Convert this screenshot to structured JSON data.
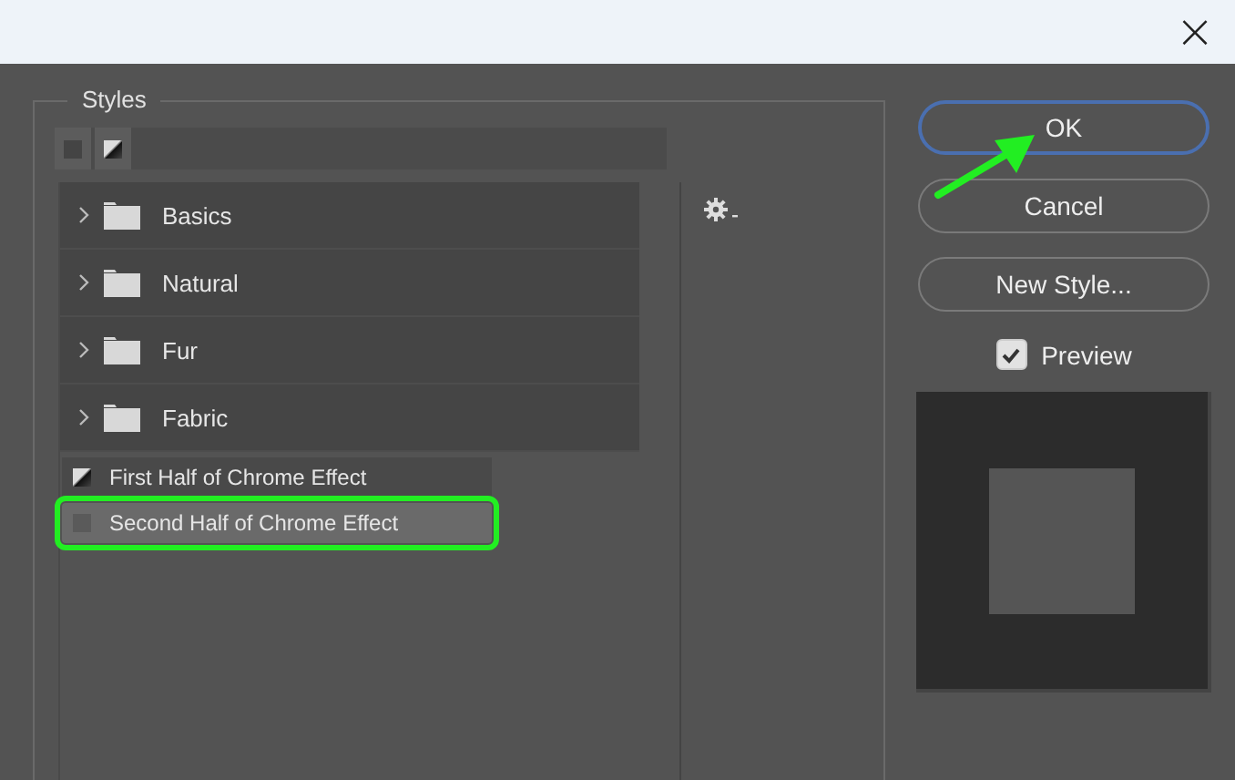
{
  "window": {
    "close": "×"
  },
  "styles": {
    "legend": "Styles",
    "folders": [
      {
        "name": "Basics",
        "expanded": false
      },
      {
        "name": "Natural",
        "expanded": false
      },
      {
        "name": "Fur",
        "expanded": false
      },
      {
        "name": "Fabric",
        "expanded": false
      }
    ],
    "items": [
      {
        "name": "First Half of Chrome Effect",
        "kind": "chrome",
        "selected": false,
        "highlighted": false
      },
      {
        "name": "Second Half of Chrome Effect",
        "kind": "plain",
        "selected": true,
        "highlighted": true
      }
    ]
  },
  "buttons": [
    {
      "label": "OK",
      "default": true,
      "pointed": true
    },
    {
      "label": "Cancel",
      "default": false,
      "pointed": false
    },
    {
      "label": "New Style...",
      "default": false,
      "pointed": false
    }
  ],
  "preview": {
    "label": "Preview",
    "checked": true
  }
}
